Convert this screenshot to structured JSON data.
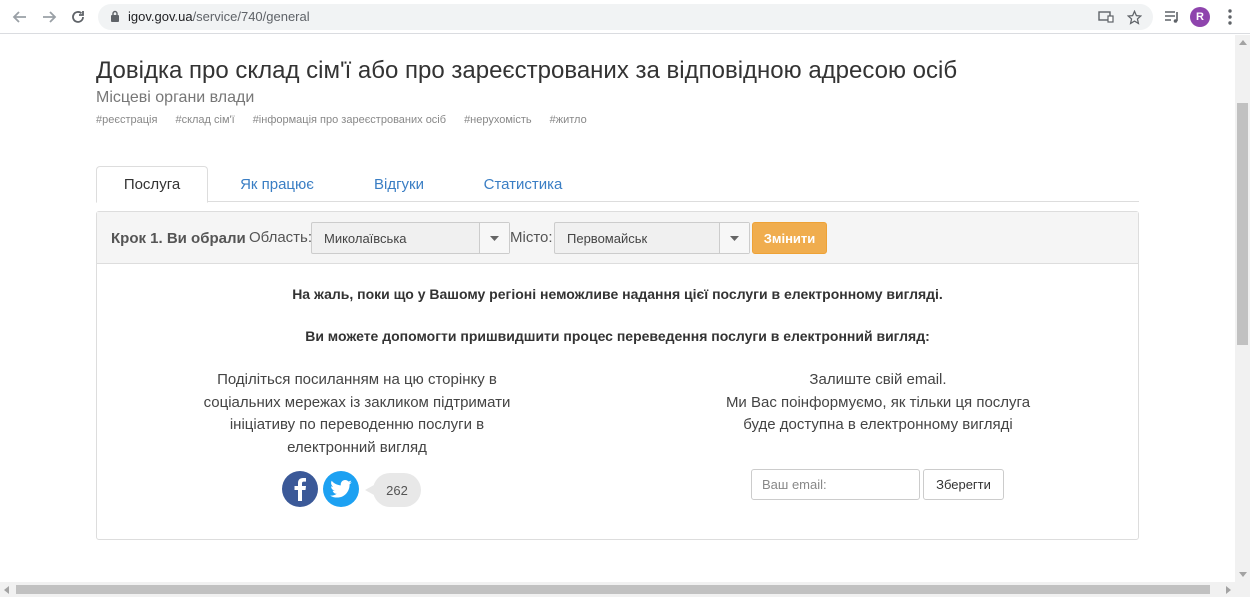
{
  "browser": {
    "url_domain": "igov.gov.ua",
    "url_path": "/service/740/general",
    "profile_initial": "R"
  },
  "page": {
    "title": "Довідка про склад сім'ї або про зареєстрованих за відповідною адресою осіб",
    "subtitle": "Місцеві органи влади",
    "tags": [
      "#реєстрація",
      "#склад сім'ї",
      "#інформація про зареєстрованих осіб",
      "#нерухомість",
      "#житло"
    ]
  },
  "tabs": [
    {
      "label": "Послуга",
      "active": true
    },
    {
      "label": "Як працює",
      "active": false
    },
    {
      "label": "Відгуки",
      "active": false
    },
    {
      "label": "Статистика",
      "active": false
    }
  ],
  "step": {
    "label": "Крок 1. Ви обрали",
    "region_label": "Область:",
    "region_value": "Миколаївська",
    "city_label": "Місто:",
    "city_value": "Первомайськ",
    "change_button": "Змінити"
  },
  "content": {
    "message1": "На жаль, поки що у Вашому регіоні неможливе надання цієї послуги в електронному вигляді.",
    "message2": "Ви можете допомогти пришвидшити процес переведення послуги в електронний вигляд:",
    "share_text": [
      "Поділіться посиланням на цю сторінку в",
      "соціальних мережах із закликом підтримати",
      "ініціативу по переводенню послуги в",
      "електронний вигляд"
    ],
    "email_text": [
      "Залиште свій email.",
      "Ми Вас поінформуємо, як тільки ця послуга",
      "буде доступна в електронному вигляді"
    ],
    "share_count": "262",
    "email_placeholder": "Ваш email:",
    "save_button": "Зберегти"
  },
  "colors": {
    "accent_orange": "#f0ad4e",
    "link_blue": "#3a7ec4",
    "facebook": "#3b5998",
    "twitter": "#1da1f2"
  }
}
